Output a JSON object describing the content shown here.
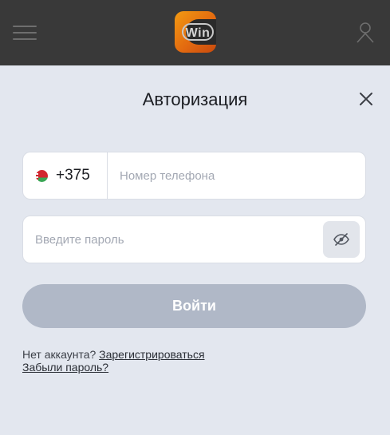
{
  "header": {
    "menu_icon": "hamburger-menu-icon",
    "logo_text": "Win",
    "user_icon": "user-profile-icon"
  },
  "dialog": {
    "title": "Авторизация",
    "close_icon": "close-icon"
  },
  "phone": {
    "country_flag": "belarus-flag-icon",
    "country_code": "+375",
    "placeholder": "Номер телефона",
    "value": ""
  },
  "password": {
    "placeholder": "Введите пароль",
    "value": "",
    "toggle_icon": "eye-hidden-icon"
  },
  "submit": {
    "label": "Войти"
  },
  "footer": {
    "no_account_text": "Нет аккаунта?",
    "register_link": "Зарегистрироваться",
    "forgot_link": "Забыли пароль?"
  },
  "colors": {
    "topbar": "#393939",
    "background": "#e3e7ef",
    "button_disabled": "#b0b8c7",
    "logo_orange": "#f29a12"
  }
}
